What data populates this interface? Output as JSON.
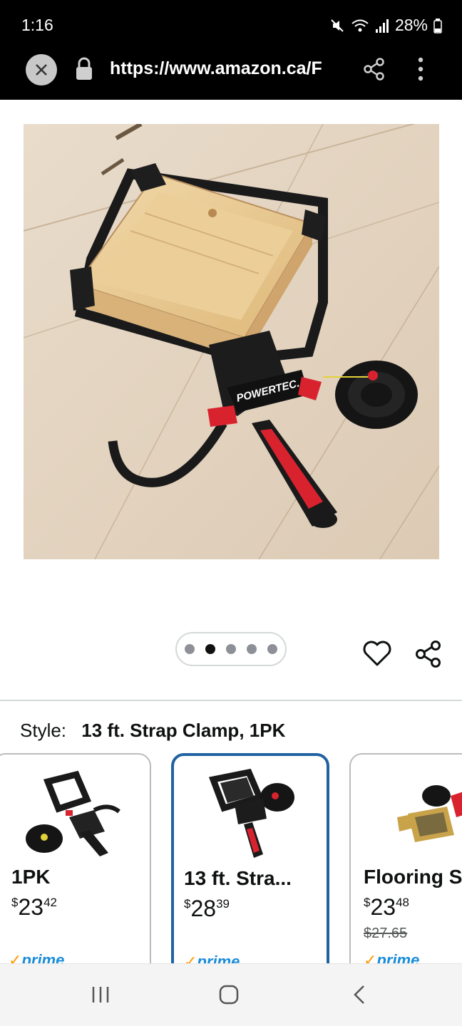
{
  "status_bar": {
    "time": "1:16",
    "battery": "28%",
    "icons": [
      "mute-icon",
      "wifi-icon",
      "signal-icon",
      "battery-icon"
    ]
  },
  "browser": {
    "url": "https://www.amazon.ca/F",
    "icons": [
      "close-icon",
      "lock-icon",
      "share-icon",
      "more-vert-icon"
    ]
  },
  "gallery": {
    "dot_count": 5,
    "active_index": 1,
    "icons": [
      "heart-icon",
      "share-icon"
    ]
  },
  "style": {
    "label": "Style:",
    "value": "13 ft. Strap Clamp, 1PK"
  },
  "variants": [
    {
      "title": "1PK",
      "currency": "$",
      "price_whole": "23",
      "price_fraction": "42",
      "old_price": "",
      "prime": "prime",
      "selected": false
    },
    {
      "title": "13 ft. Stra...",
      "currency": "$",
      "price_whole": "28",
      "price_fraction": "39",
      "old_price": "",
      "prime": "prime",
      "selected": true
    },
    {
      "title": "Flooring S",
      "currency": "$",
      "price_whole": "23",
      "price_fraction": "48",
      "old_price": "$27.65",
      "prime": "prime",
      "selected": false
    }
  ],
  "colors": {
    "selected_border": "#2162a1",
    "prime_blue": "#1a8cd8",
    "prime_check": "#ff9900",
    "clamp_red": "#d8232f"
  },
  "nav": {
    "icons": [
      "recents-icon",
      "home-icon",
      "back-icon"
    ]
  }
}
